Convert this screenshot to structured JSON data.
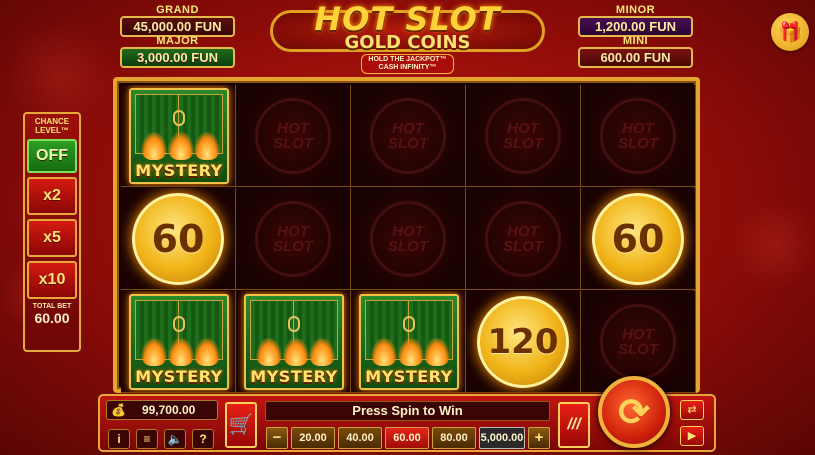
{
  "jackpots": {
    "grand": {
      "label": "GRAND",
      "value": "45,000.00 FUN"
    },
    "major": {
      "label": "MAJOR",
      "value": "3,000.00 FUN"
    },
    "minor": {
      "label": "MINOR",
      "value": "1,200.00 FUN"
    },
    "mini": {
      "label": "MINI",
      "value": "600.00 FUN"
    }
  },
  "logo": {
    "title": "HOT SLOT",
    "subtitle": "GOLD COINS",
    "tagline_1": "HOLD THE JACKPOT™",
    "tagline_2": "CASH INFINITY™"
  },
  "chance": {
    "title_1": "CHANCE",
    "title_2": "LEVEL™",
    "options": [
      "OFF",
      "x2",
      "x5",
      "x10"
    ],
    "selected": "OFF",
    "total_bet_label": "TOTAL BET",
    "total_bet_value": "60.00"
  },
  "reels": {
    "mystery_label": "MYSTERY",
    "ghost_label": "HOT SLOT",
    "rows": [
      [
        "MYSTERY",
        "",
        "",
        "",
        ""
      ],
      [
        "60",
        "",
        "",
        "",
        "60"
      ],
      [
        "MYSTERY",
        "MYSTERY",
        "MYSTERY",
        "120",
        ""
      ]
    ]
  },
  "bottom_bar": {
    "balance": "99,700.00",
    "message": "Press Spin to Win",
    "bets": [
      "20.00",
      "40.00",
      "60.00",
      "80.00",
      "5,000.00"
    ],
    "selected_bet": "60.00",
    "minus": "−",
    "plus": "+",
    "info": "i",
    "menu": "≡",
    "sound": "🔈",
    "help": "?"
  },
  "icons": {
    "gift": "gift-icon",
    "cart": "cart-icon",
    "turbo": "turbo-icon",
    "spin": "spin-icon",
    "autoplay": "autoplay-icon",
    "fullscreen": "fullscreen-icon",
    "wallet": "wallet-icon"
  },
  "colors": {
    "gold": "#e6a83a",
    "red": "#c41a12",
    "green": "#2e9e24"
  }
}
